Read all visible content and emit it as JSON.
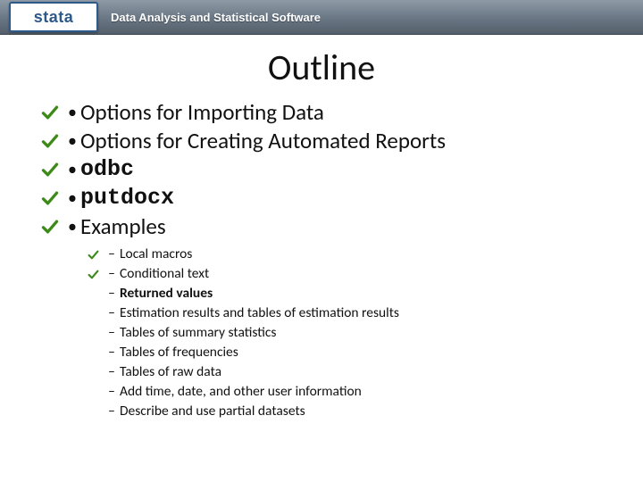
{
  "header": {
    "logo_text": "stata",
    "tagline": "Data Analysis and Statistical Software"
  },
  "title": "Outline",
  "main_items": [
    {
      "checked": true,
      "text": "Options for Importing Data",
      "mono": false
    },
    {
      "checked": true,
      "text": "Options for Creating Automated Reports",
      "mono": false
    },
    {
      "checked": true,
      "text": "odbc",
      "mono": true
    },
    {
      "checked": true,
      "text": "putdocx",
      "mono": true
    },
    {
      "checked": true,
      "text": "Examples",
      "mono": false
    }
  ],
  "sub_items": [
    {
      "checked": true,
      "text": "Local macros",
      "bold": false
    },
    {
      "checked": true,
      "text": "Conditional text",
      "bold": false
    },
    {
      "checked": false,
      "text": "Returned values",
      "bold": true
    },
    {
      "checked": false,
      "text": "Estimation results and tables of estimation results",
      "bold": false
    },
    {
      "checked": false,
      "text": "Tables of summary statistics",
      "bold": false
    },
    {
      "checked": false,
      "text": "Tables of frequencies",
      "bold": false
    },
    {
      "checked": false,
      "text": "Tables of raw data",
      "bold": false
    },
    {
      "checked": false,
      "text": "Add time, date, and other user information",
      "bold": false
    },
    {
      "checked": false,
      "text": "Describe and use partial datasets",
      "bold": false
    }
  ]
}
